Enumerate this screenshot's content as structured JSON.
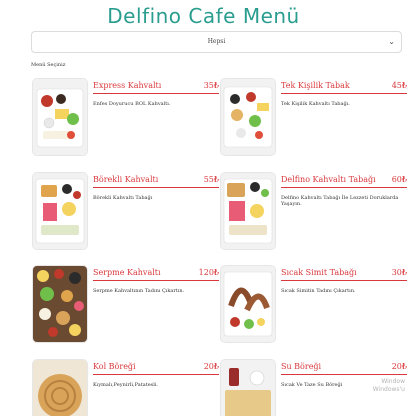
{
  "page": {
    "title": "Delfino Cafe Menü",
    "category_select": {
      "selected": "Hepsi"
    },
    "caption": "Menü Seçiniz",
    "watermark": {
      "line1": "Window",
      "line2": "Windows'u"
    }
  },
  "menu": [
    {
      "name": "Express Kahvaltı",
      "price": "35₺",
      "desc": "Enfes Doyurucu BOL Kahvaltı."
    },
    {
      "name": "Tek Kişilik Tabak",
      "price": "45₺",
      "desc": "Tek Kişilik Kahvaltı Tabağı."
    },
    {
      "name": "Börekli Kahvaltı",
      "price": "55₺",
      "desc": "Börekli Kahvaltı Tabağı"
    },
    {
      "name": "Delfino Kahvaltı Tabağı",
      "price": "60₺",
      "desc": "Delfino Kahvaltı Tabağı İle Lezzeti Doruklarda Yaşayın."
    },
    {
      "name": "Serpme Kahvaltı",
      "price": "120₺",
      "desc": "Serpme Kahvaltının Tadını Çıkartın."
    },
    {
      "name": "Sıcak Simit Tabağı",
      "price": "30₺",
      "desc": "Sıcak Simitin Tadını Çıkartın."
    },
    {
      "name": "Kol Böreği",
      "price": "20₺",
      "desc": "Kıymalı,Peynirli,Patatesli."
    },
    {
      "name": "Su Böreği",
      "price": "20₺",
      "desc": "Sıcak Ve Taze Su Böreği"
    }
  ]
}
